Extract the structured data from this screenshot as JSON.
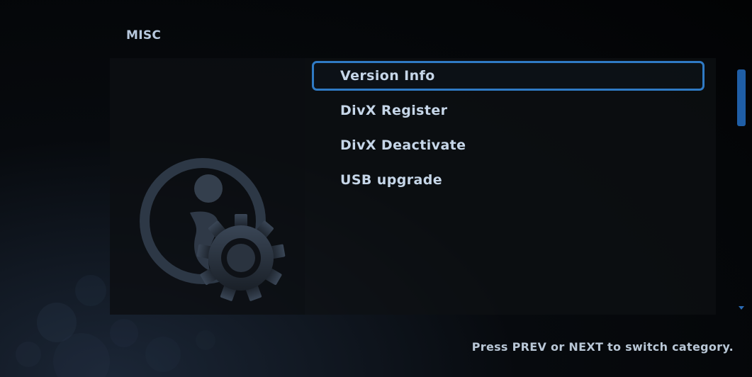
{
  "category": {
    "title": "MISC"
  },
  "menu": {
    "items": [
      {
        "label": "Version Info",
        "selected": true
      },
      {
        "label": "DivX Register",
        "selected": false
      },
      {
        "label": "DivX Deactivate",
        "selected": false
      },
      {
        "label": "USB upgrade",
        "selected": false
      }
    ]
  },
  "footer": {
    "hint": "Press PREV or NEXT to switch category."
  },
  "icons": {
    "category_icon": "misc-info-gear-icon"
  },
  "colors": {
    "selection_border": "#2f7ac4",
    "scrollbar_thumb": "#1f5ea6",
    "text": "#c6d6e8",
    "background": "#05070a"
  }
}
